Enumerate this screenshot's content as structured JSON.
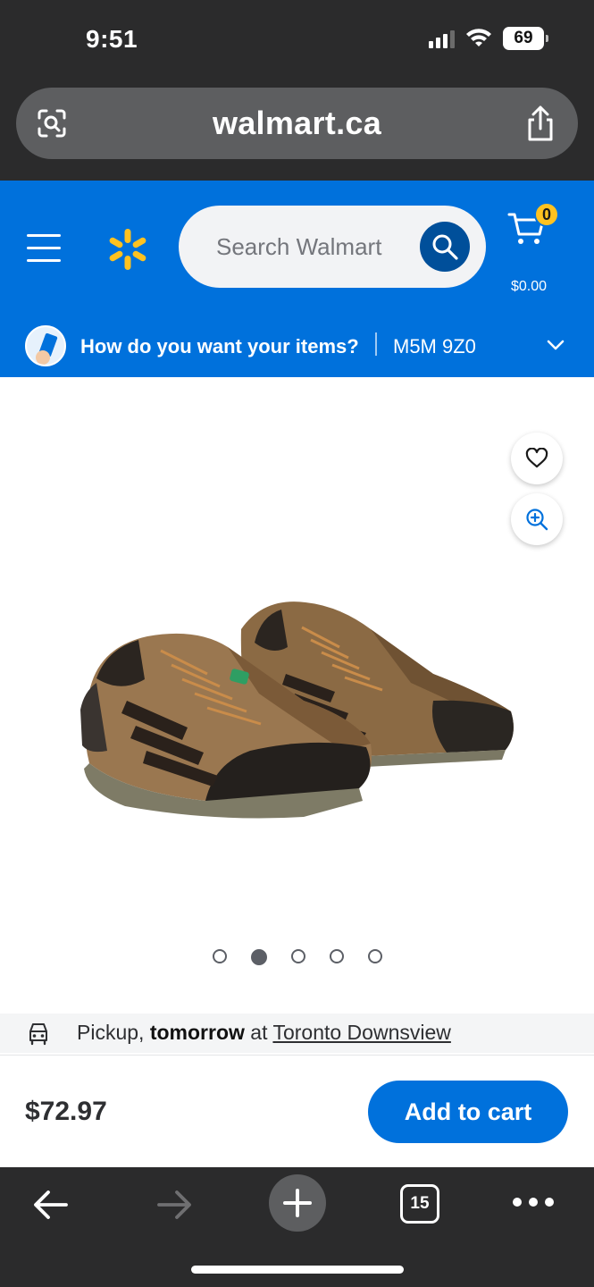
{
  "status_bar": {
    "time": "9:51",
    "battery": "69"
  },
  "browser": {
    "url": "walmart.ca",
    "tab_count": "15"
  },
  "header": {
    "search_placeholder": "Search Walmart",
    "cart_count": "0",
    "cart_total": "$0.00",
    "delivery_question": "How do you want your items?",
    "postal_code": "M5M 9Z0"
  },
  "product": {
    "image_icon": "work-shoes-image",
    "carousel_count": 5,
    "carousel_active_index": 1
  },
  "pickup": {
    "prefix": "Pickup,",
    "day": "tomorrow",
    "connector": "at",
    "store": "Toronto Downsview"
  },
  "purchase": {
    "price": "$72.97",
    "add_to_cart_label": "Add to cart"
  },
  "colors": {
    "walmart_blue": "#0071dc",
    "walmart_yellow": "#ffc220",
    "search_button": "#004f9a",
    "chrome_dark": "#2b2b2c"
  }
}
